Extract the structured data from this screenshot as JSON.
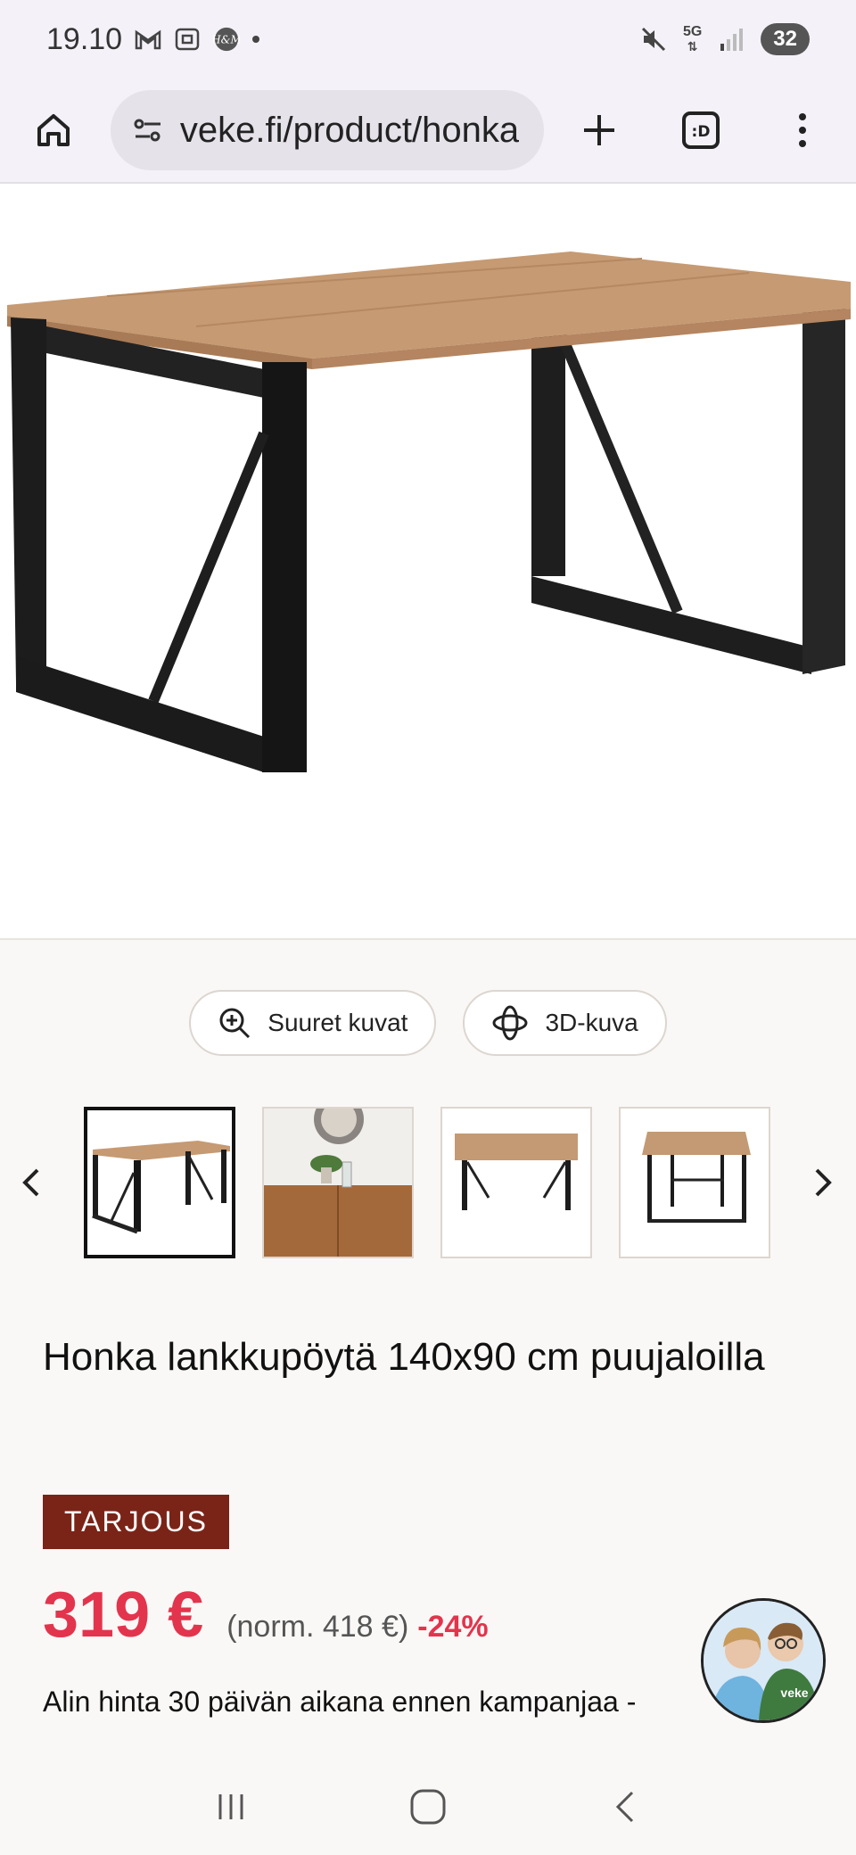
{
  "status_bar": {
    "time": "19.10",
    "network": "5G",
    "battery": "32"
  },
  "browser": {
    "url": "veke.fi/product/honka"
  },
  "media_buttons": {
    "large_images": "Suuret kuvat",
    "view_3d": "3D-kuva"
  },
  "product": {
    "title": "Honka lankkupöytä 140x90 cm puujaloilla",
    "badge": "TARJOUS",
    "price": "319 €",
    "normal_price": "(norm. 418 €)",
    "discount": "-24%",
    "lowest_price_note": "Alin hinta 30 päivän aikana ennen kampanjaa -"
  },
  "chat": {
    "avatar_text": "veke"
  },
  "colors": {
    "price_red": "#e3344d",
    "badge_bg": "#7a2418",
    "page_bg": "#faf8f6"
  }
}
